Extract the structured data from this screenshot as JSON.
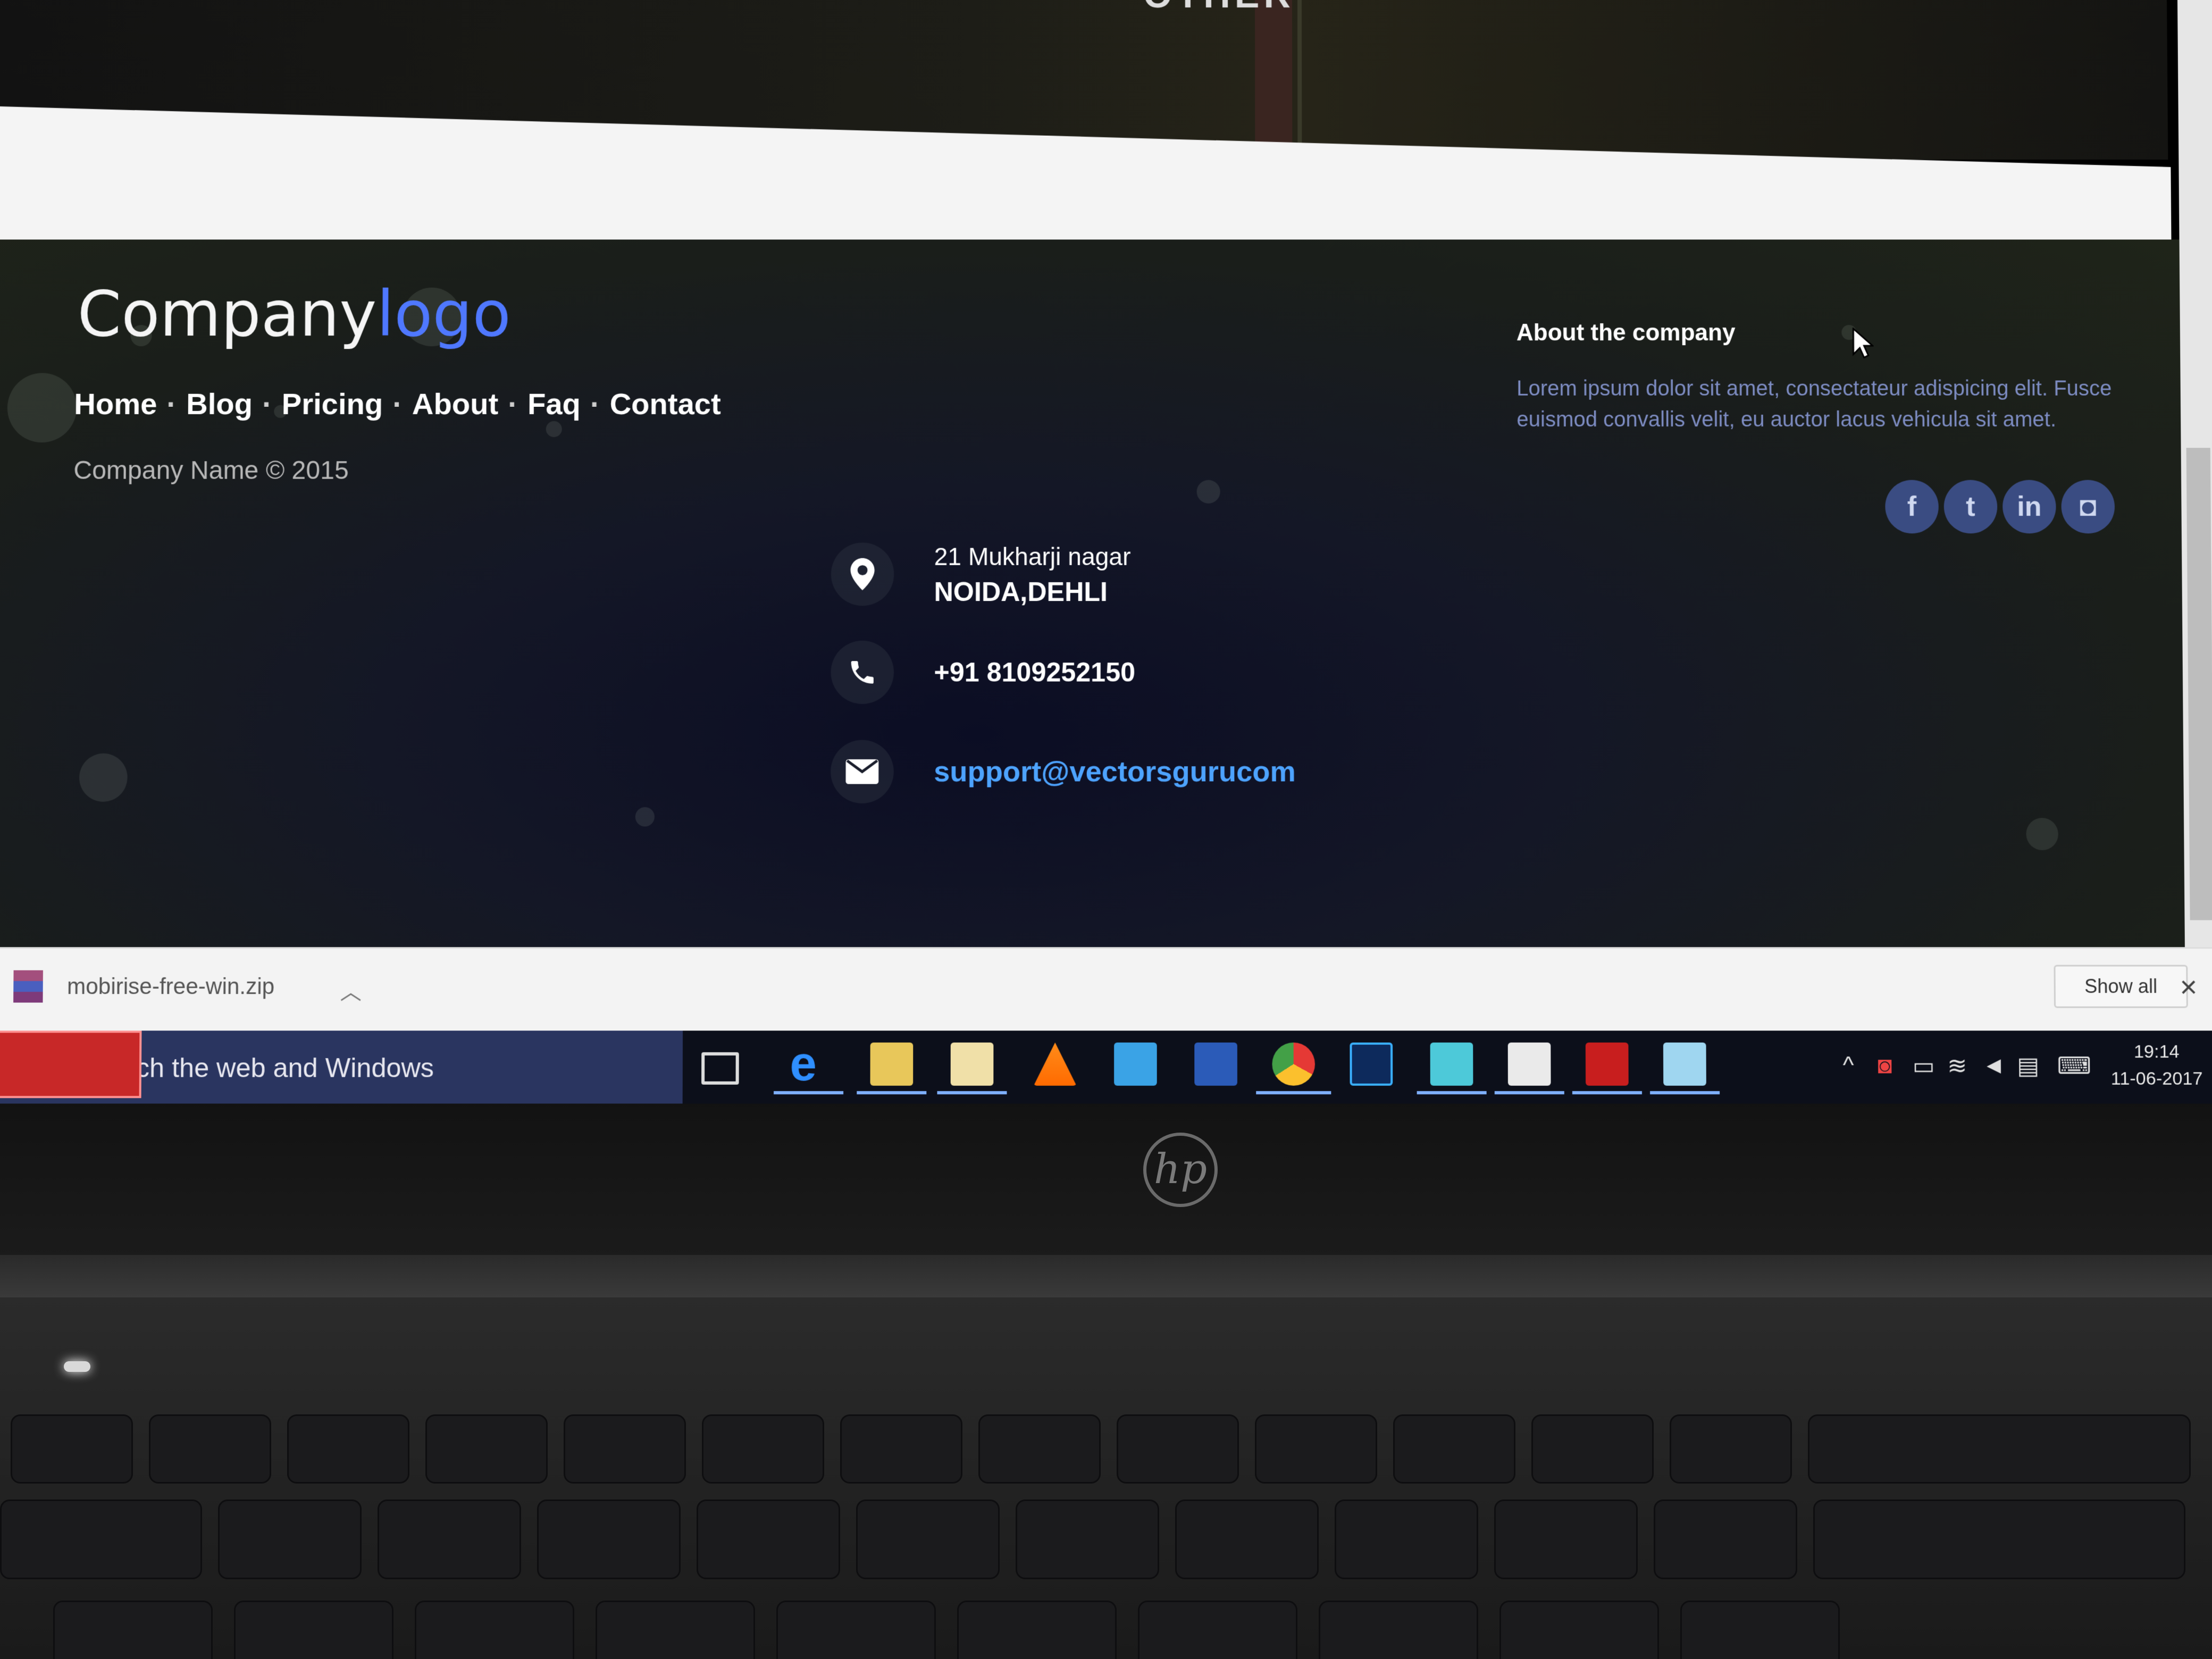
{
  "hero": {
    "title": "OTHER"
  },
  "footer": {
    "logo": {
      "part1": "Company",
      "part2": "logo"
    },
    "nav": [
      "Home",
      "Blog",
      "Pricing",
      "About",
      "Faq",
      "Contact"
    ],
    "nav_separator": "·",
    "copyright": "Company Name © 2015",
    "contact": {
      "address_line1": "21 Mukharji nagar",
      "address_line2": "NOIDA,DEHLI",
      "phone": "+91 8109252150",
      "email": "support@vectorsgurucom"
    },
    "about": {
      "title": "About the company",
      "body": "Lorem ipsum dolor sit amet, consectateur adispicing elit. Fusce euismod convallis velit, eu auctor lacus vehicula sit amet."
    },
    "social": [
      {
        "icon": "facebook-icon",
        "glyph": "f"
      },
      {
        "icon": "twitter-icon",
        "glyph": "t"
      },
      {
        "icon": "linkedin-icon",
        "glyph": "in"
      },
      {
        "icon": "instagram-icon",
        "glyph": "◘"
      }
    ]
  },
  "download_bar": {
    "file_name": "mobirise-free-win.zip",
    "show_all_label": "Show all"
  },
  "taskbar": {
    "search_placeholder": "ch the web and Windows",
    "time": "19:14",
    "date": "11-06-2017"
  },
  "laptop": {
    "brand": "hp"
  },
  "colors": {
    "logo_accent": "#4f78ff",
    "email_link": "#4da3ff",
    "about_text": "#7d8cc2"
  }
}
